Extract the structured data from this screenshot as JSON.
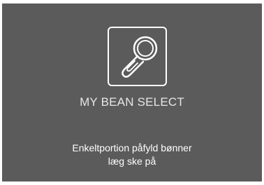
{
  "screen": {
    "background_color": "#5b5b5b",
    "icon": "scoop-icon",
    "title": "MY BEAN SELECT",
    "message_line1": "Enkeltportion påfyld bønner",
    "message_line2": "læg ske på"
  }
}
